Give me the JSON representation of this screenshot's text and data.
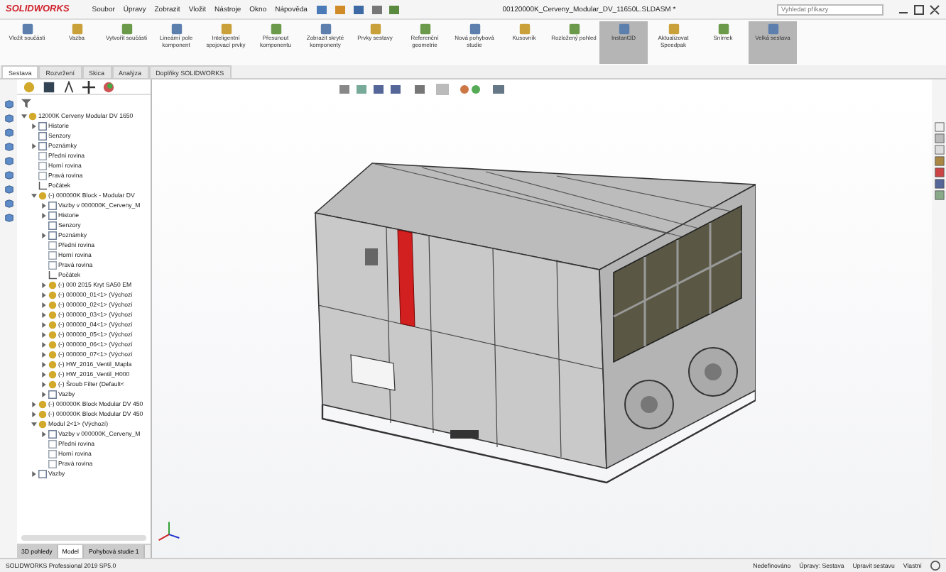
{
  "app": {
    "name": "SOLIDWORKS",
    "title": "00120000K_Cerveny_Modular_DV_11650L.SLDASM *"
  },
  "menu": [
    "Soubor",
    "Úpravy",
    "Zobrazit",
    "Vložit",
    "Nástroje",
    "Okno",
    "Nápověda"
  ],
  "search": {
    "placeholder": "Vyhledat příkazy"
  },
  "commands": [
    {
      "label": "Vložit součásti",
      "selected": false
    },
    {
      "label": "Vazba",
      "selected": false
    },
    {
      "label": "Vytvořit součásti",
      "selected": false
    },
    {
      "label": "Lineární pole komponent",
      "selected": false
    },
    {
      "label": "Inteligentní spojovací prvky",
      "selected": false
    },
    {
      "label": "Přesunout komponentu",
      "selected": false
    },
    {
      "label": "Zobrazit skryté komponenty",
      "selected": false
    },
    {
      "label": "Prvky sestavy",
      "selected": false
    },
    {
      "label": "Referenční geometrie",
      "selected": false
    },
    {
      "label": "Nová pohybová studie",
      "selected": false
    },
    {
      "label": "Kusovník",
      "selected": false
    },
    {
      "label": "Rozložený pohled",
      "selected": false
    },
    {
      "label": "Instant3D",
      "selected": true
    },
    {
      "label": "Aktualizovat Speedpak",
      "selected": false
    },
    {
      "label": "Snímek",
      "selected": false
    },
    {
      "label": "Velká sestava",
      "selected": true
    }
  ],
  "tabs": [
    {
      "label": "Sestava",
      "selected": true
    },
    {
      "label": "Rozvržení",
      "selected": false
    },
    {
      "label": "Skica",
      "selected": false
    },
    {
      "label": "Analýza",
      "selected": false
    },
    {
      "label": "Doplňky SOLIDWORKS",
      "selected": false
    }
  ],
  "tree": [
    {
      "label": "12000K Cerveny Modular DV 1650",
      "kind": "assembly",
      "expanded": true,
      "children": [
        {
          "label": "Historie",
          "kind": "folder",
          "expanded": false
        },
        {
          "label": "Senzory",
          "kind": "folder"
        },
        {
          "label": "Poznámky",
          "kind": "folder",
          "expanded": false
        },
        {
          "label": "Přední rovina",
          "kind": "plane"
        },
        {
          "label": "Horní rovina",
          "kind": "plane"
        },
        {
          "label": "Pravá rovina",
          "kind": "plane"
        },
        {
          "label": "Počátek",
          "kind": "origin"
        },
        {
          "label": "(-) 000000K Block - Modular DV",
          "kind": "assembly",
          "expanded": true,
          "children": [
            {
              "label": "Vazby v 000000K_Cerveny_M",
              "kind": "folder",
              "expanded": false
            },
            {
              "label": "Historie",
              "kind": "folder",
              "expanded": false
            },
            {
              "label": "Senzory",
              "kind": "folder"
            },
            {
              "label": "Poznámky",
              "kind": "folder",
              "expanded": false
            },
            {
              "label": "Přední rovina",
              "kind": "plane"
            },
            {
              "label": "Horní rovina",
              "kind": "plane"
            },
            {
              "label": "Pravá rovina",
              "kind": "plane"
            },
            {
              "label": "Počátek",
              "kind": "origin"
            },
            {
              "label": "(-) 000 2015 Kryt SA50 EM",
              "kind": "assembly",
              "expanded": false
            },
            {
              "label": "(-) 000000_01<1> (Výchozí",
              "kind": "assembly",
              "expanded": false
            },
            {
              "label": "(-) 000000_02<1> (Výchozí",
              "kind": "assembly",
              "expanded": false
            },
            {
              "label": "(-) 000000_03<1> (Výchozí",
              "kind": "assembly",
              "expanded": false
            },
            {
              "label": "(-) 000000_04<1> (Výchozí",
              "kind": "assembly",
              "expanded": false
            },
            {
              "label": "(-) 000000_05<1> (Výchozí",
              "kind": "assembly",
              "expanded": false
            },
            {
              "label": "(-) 000000_06<1> (Výchozí",
              "kind": "assembly",
              "expanded": false
            },
            {
              "label": "(-) 000000_07<1> (Výchozí",
              "kind": "assembly",
              "expanded": false
            },
            {
              "label": "(-) HW_2016_Ventil_Mapla",
              "kind": "assembly",
              "expanded": false
            },
            {
              "label": "(-) HW_2016_Ventil_H000",
              "kind": "assembly",
              "expanded": false
            },
            {
              "label": "(-) Šroub Filter (Default<",
              "kind": "assembly",
              "expanded": false
            },
            {
              "label": "Vazby",
              "kind": "folder",
              "expanded": false
            }
          ]
        },
        {
          "label": "(-) 000000K Block Modular DV 450",
          "kind": "assembly",
          "expanded": false
        },
        {
          "label": "(-) 000000K Block Modular DV 450",
          "kind": "assembly",
          "expanded": false
        },
        {
          "label": "Modul 2<1> (Výchozí)",
          "kind": "assembly",
          "expanded": true,
          "children": [
            {
              "label": "Vazby v 000000K_Cerveny_M",
              "kind": "folder",
              "expanded": false
            },
            {
              "label": "Přední rovina",
              "kind": "plane"
            },
            {
              "label": "Horní rovina",
              "kind": "plane"
            },
            {
              "label": "Pravá rovina",
              "kind": "plane"
            }
          ]
        },
        {
          "label": "Vazby",
          "kind": "folder",
          "expanded": false
        }
      ]
    }
  ],
  "bottom_tabs": [
    {
      "label": "3D pohledy",
      "selected": false
    },
    {
      "label": "Model",
      "selected": true
    },
    {
      "label": "Pohybová studie 1",
      "selected": false
    }
  ],
  "status_bar": {
    "left": "SOLIDWORKS Professional 2019 SP5.0",
    "items": [
      "Nedefinováno",
      "Úpravy: Sestava",
      "Upravit sestavu",
      "Vlastní"
    ]
  }
}
